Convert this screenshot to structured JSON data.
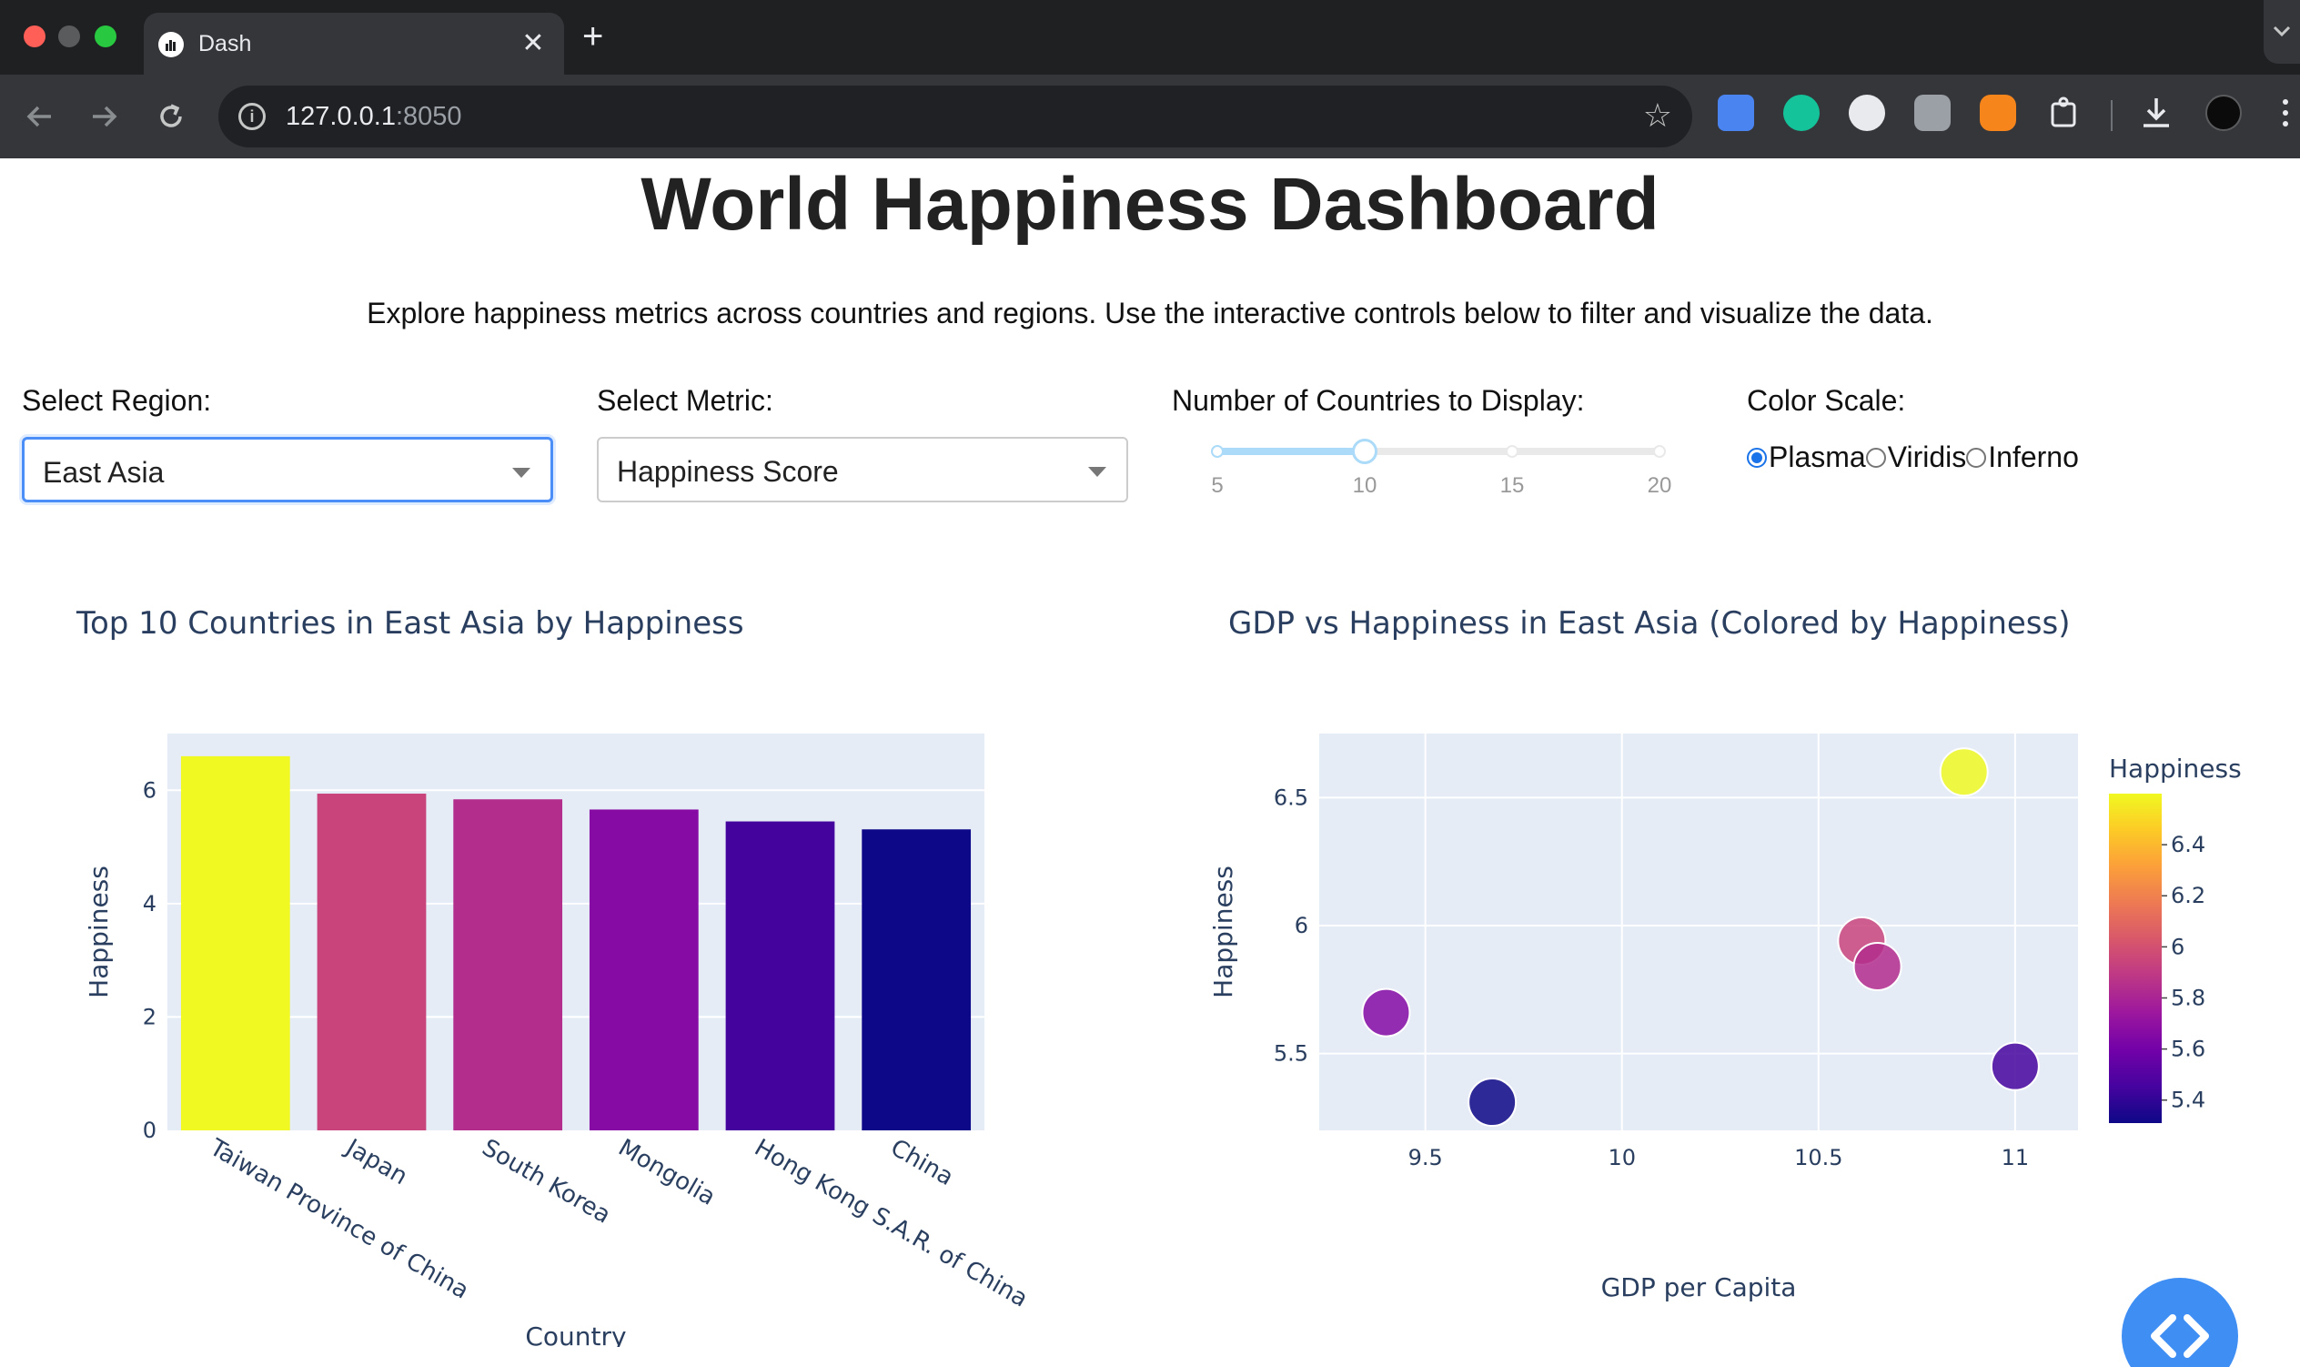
{
  "browser": {
    "tab_title": "Dash",
    "tab_close": "✕",
    "new_tab": "+",
    "url_host": "127.0.0.1",
    "url_port": ":8050"
  },
  "page": {
    "title": "World Happiness Dashboard",
    "subtitle": "Explore happiness metrics across countries and regions. Use the interactive controls below to filter and visualize the data."
  },
  "controls": {
    "region_label": "Select Region:",
    "region_value": "East Asia",
    "metric_label": "Select Metric:",
    "metric_value": "Happiness Score",
    "countries_label": "Number of Countries to Display:",
    "slider_marks": [
      "5",
      "10",
      "15",
      "20"
    ],
    "slider_min": 5,
    "slider_max": 20,
    "slider_value": 10,
    "color_scale_label": "Color Scale:",
    "color_scale_options": [
      "Plasma",
      "Viridis",
      "Inferno"
    ],
    "color_scale_selected": "Plasma"
  },
  "colors": {
    "plot_bg": "#e5ecf6",
    "colorscale": [
      "#0d0887",
      "#46039f",
      "#7201a8",
      "#9c179e",
      "#bd3786",
      "#d8576b",
      "#ed7953",
      "#fb9f3a",
      "#fdca26",
      "#f0f921"
    ]
  },
  "chart_data": [
    {
      "type": "bar",
      "title": "Top 10 Countries in East Asia by Happiness",
      "xlabel": "Country",
      "ylabel": "Happiness",
      "categories": [
        "Taiwan Province of China",
        "Japan",
        "South Korea",
        "Mongolia",
        "Hong Kong S.A.R. of China",
        "China"
      ],
      "values": [
        6.6,
        5.94,
        5.84,
        5.66,
        5.45,
        5.31
      ],
      "ylim": [
        0,
        7
      ],
      "yticks": [
        "0",
        "2",
        "4",
        "6"
      ],
      "grid": true,
      "colored_by": "Happiness"
    },
    {
      "type": "scatter",
      "title": "GDP vs Happiness in East Asia (Colored by Happiness)",
      "xlabel": "GDP per Capita",
      "ylabel": "Happiness",
      "x": [
        10.87,
        10.61,
        10.65,
        9.4,
        11.0,
        9.67
      ],
      "y": [
        6.6,
        5.94,
        5.84,
        5.66,
        5.45,
        5.31
      ],
      "xlim": [
        9.23,
        11.16
      ],
      "ylim": [
        5.2,
        6.75
      ],
      "xticks": [
        "9.5",
        "10",
        "10.5",
        "11"
      ],
      "yticks": [
        "5.5",
        "6",
        "6.5"
      ],
      "colorbar_title": "Happiness",
      "colorbar_ticks": [
        "5.4",
        "5.6",
        "5.8",
        "6",
        "6.2",
        "6.4"
      ],
      "color_range": [
        5.31,
        6.6
      ],
      "grid": true
    }
  ]
}
